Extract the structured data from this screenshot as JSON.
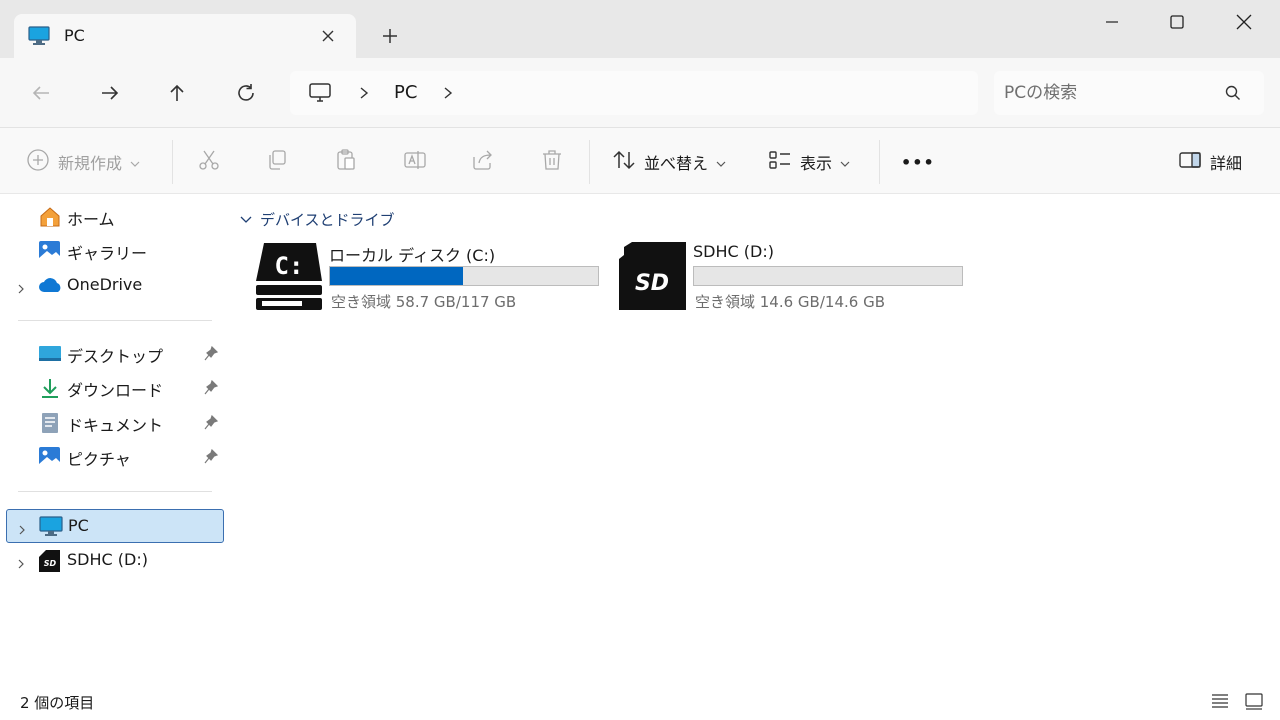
{
  "tab": {
    "title": "PC"
  },
  "address": {
    "crumb": "PC"
  },
  "search": {
    "placeholder": "PCの検索"
  },
  "toolbar": {
    "new_label": "新規作成",
    "sort_label": "並べ替え",
    "view_label": "表示",
    "details_label": "詳細",
    "more_label": "•••"
  },
  "sidebar": {
    "items": [
      {
        "label": "ホーム",
        "icon": "home-icon"
      },
      {
        "label": "ギャラリー",
        "icon": "gallery-icon"
      },
      {
        "label": "OneDrive",
        "icon": "onedrive-cloud-icon"
      },
      {
        "label": "デスクトップ",
        "icon": "desktop-icon",
        "pinned": true
      },
      {
        "label": "ダウンロード",
        "icon": "download-icon",
        "pinned": true
      },
      {
        "label": "ドキュメント",
        "icon": "document-icon",
        "pinned": true
      },
      {
        "label": "ピクチャ",
        "icon": "pictures-icon",
        "pinned": true
      },
      {
        "label": "PC",
        "icon": "pc-icon",
        "selected": true
      },
      {
        "label": "SDHC (D:)",
        "icon": "sd-card-icon"
      }
    ]
  },
  "main": {
    "group_title": "デバイスとドライブ",
    "drives": [
      {
        "name": "ローカル ディスク (C:)",
        "free_text": "空き領域 58.7 GB/117 GB",
        "used_fraction": 0.498,
        "icon": "c-drive-icon"
      },
      {
        "name": "SDHC (D:)",
        "free_text": "空き領域 14.6 GB/14.6 GB",
        "used_fraction": 0.0,
        "icon": "sd-card-icon"
      }
    ]
  },
  "status": {
    "item_count": "2 個の項目"
  },
  "colors": {
    "accent": "#0067c0",
    "selection": "#cce4f7",
    "group_header": "#1f3f73"
  }
}
